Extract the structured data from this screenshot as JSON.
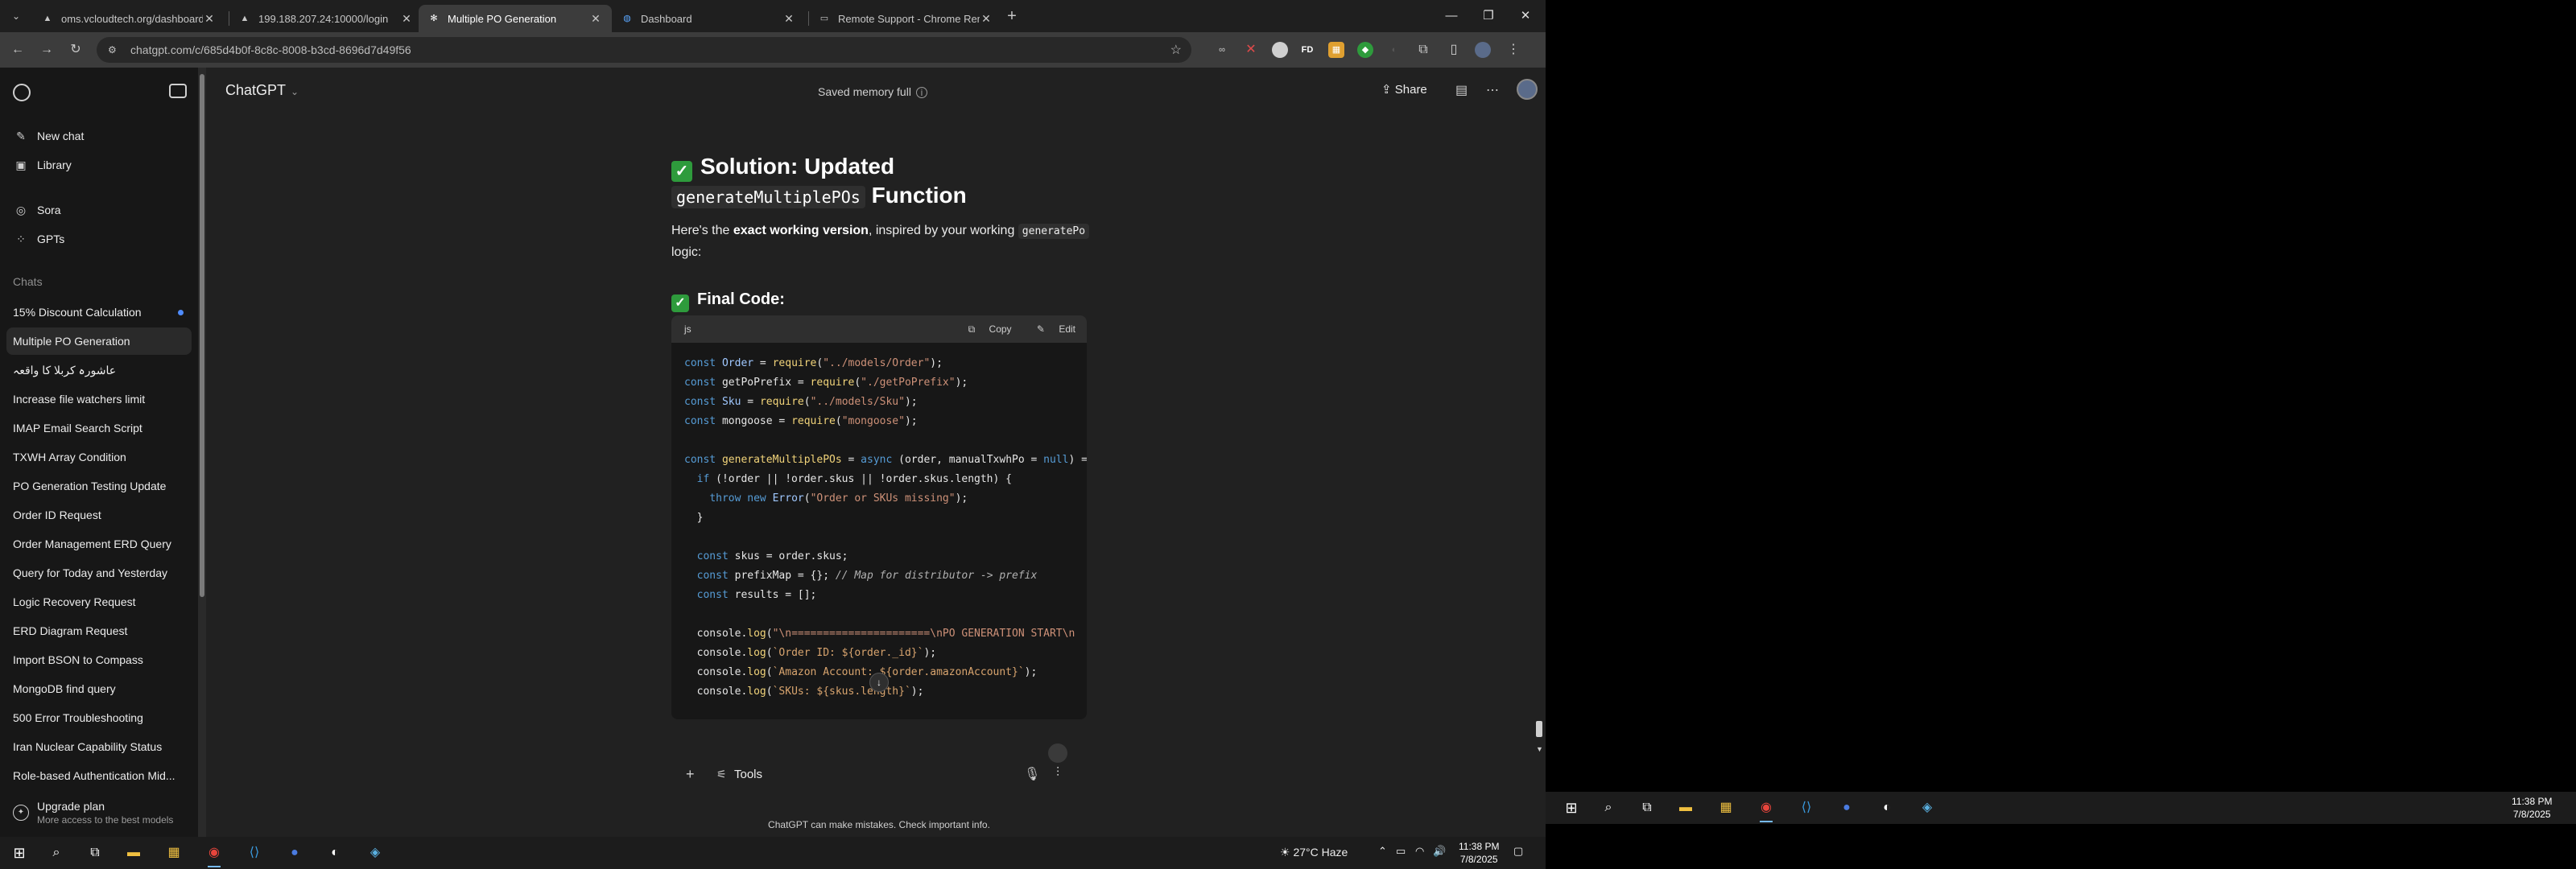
{
  "browser": {
    "tabs": [
      {
        "title": "oms.vcloudtech.org/dashboard",
        "favicon": "triangle-icon"
      },
      {
        "title": "199.188.207.24:10000/login",
        "favicon": "triangle-icon"
      },
      {
        "title": "Multiple PO Generation",
        "favicon": "chatgpt-icon",
        "active": true
      },
      {
        "title": "Dashboard",
        "favicon": "globe-icon"
      },
      {
        "title": "Remote Support - Chrome Rem",
        "favicon": "remote-icon"
      }
    ],
    "url": "chatgpt.com/c/685d4b0f-8c8c-8008-b3cd-8696d7d49f56"
  },
  "sidebar": {
    "nav": [
      {
        "label": "New chat",
        "icon": "edit-icon"
      },
      {
        "label": "Library",
        "icon": "library-icon"
      },
      {
        "label": "Sora",
        "icon": "sora-icon"
      },
      {
        "label": "GPTs",
        "icon": "grid-icon"
      }
    ],
    "chats_heading": "Chats",
    "chats": [
      "15% Discount Calculation",
      "Multiple PO Generation",
      "عاشورہ کربلا کا واقعہ",
      "Increase file watchers limit",
      "IMAP Email Search Script",
      "TXWH Array Condition",
      "PO Generation Testing Update",
      "Order ID Request",
      "Order Management ERD Query",
      "Query for Today and Yesterday",
      "Logic Recovery Request",
      "ERD Diagram Request",
      "Import BSON to Compass",
      "MongoDB find query",
      "500 Error Troubleshooting",
      "Iran Nuclear Capability Status",
      "Role-based Authentication Mid..."
    ],
    "upgrade": {
      "title": "Upgrade plan",
      "subtitle": "More access to the best models"
    }
  },
  "header": {
    "model": "ChatGPT",
    "memory_status": "Saved memory full",
    "share_label": "Share"
  },
  "conversation": {
    "heading1_prefix": "Solution: Updated",
    "heading1_code": "generateMultiplePOs",
    "heading1_suffix": "Function",
    "para_a": "Here's the ",
    "para_bold": "exact working version",
    "para_b": ", inspired by your working ",
    "para_code": "generatePo",
    "para_c": " logic:",
    "heading2": "Final Code:",
    "code_lang": "js",
    "copy_label": "Copy",
    "edit_label": "Edit"
  },
  "composer": {
    "tools_label": "Tools",
    "disclaimer": "ChatGPT can make mistakes. Check important info."
  },
  "taskbar": {
    "weather": "27°C  Haze",
    "time": "11:38 PM",
    "date": "7/8/2025"
  },
  "colors": {
    "bg": "#212121",
    "sidebar": "#171717",
    "check": "#2e9b3c",
    "accent": "#4f8cff"
  }
}
